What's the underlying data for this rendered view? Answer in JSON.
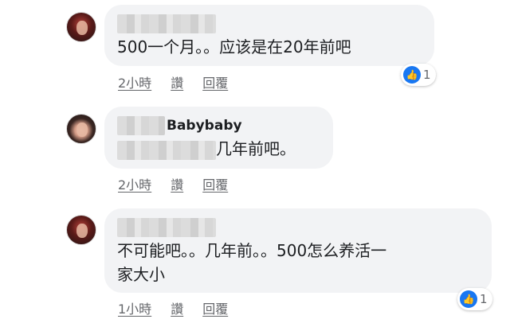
{
  "comments": [
    {
      "name": "",
      "text": "500一个月。。应该是在20年前吧",
      "actions": [
        "2小時",
        "讚",
        "回覆"
      ],
      "reaction": {
        "icon": "thumbs-up-icon",
        "count": "1"
      }
    },
    {
      "name": "Babybaby",
      "text": "几年前吧。",
      "actions": [
        "2小時",
        "讚",
        "回覆"
      ]
    },
    {
      "name": "",
      "text_line1": "不可能吧。。几年前。。500怎么养活一",
      "text_line2": "家大小",
      "actions": [
        "1小時",
        "讚",
        "回覆"
      ],
      "reaction": {
        "icon": "thumbs-up-icon",
        "count": "1"
      }
    }
  ],
  "colors": {
    "bubble": "#f2f3f5",
    "like": "#1877f2",
    "meta": "#65676b"
  }
}
